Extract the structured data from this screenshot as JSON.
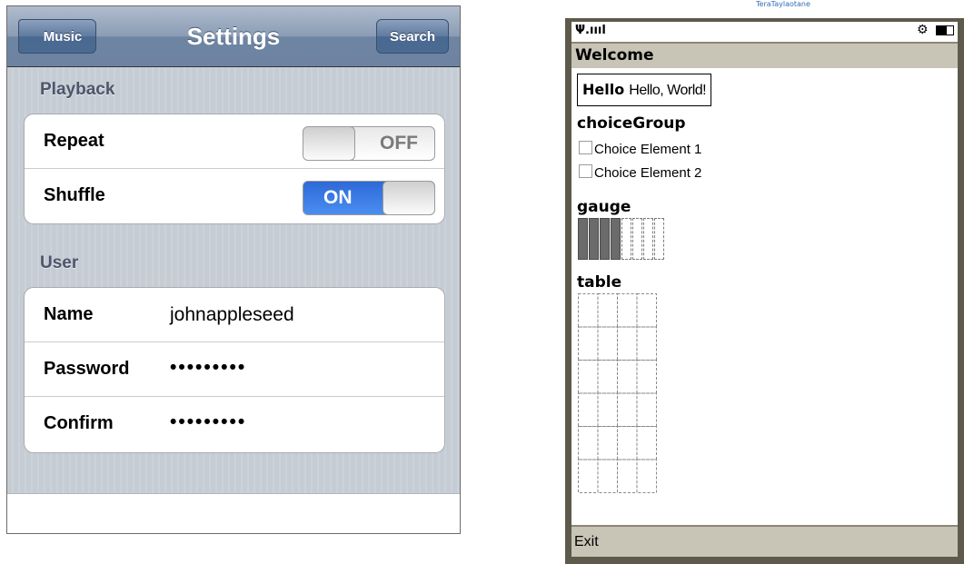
{
  "iphone": {
    "nav": {
      "title": "Settings",
      "back_label": "Music",
      "search_label": "Search"
    },
    "sections": [
      {
        "header": "Playback",
        "rows": [
          {
            "label": "Repeat",
            "switch_text": "OFF",
            "state": "off"
          },
          {
            "label": "Shuffle",
            "switch_text": "ON",
            "state": "on"
          }
        ]
      },
      {
        "header": "User",
        "rows": [
          {
            "label": "Name",
            "value": "johnappleseed"
          },
          {
            "label": "Password",
            "value": "•••••••••"
          },
          {
            "label": "Confirm",
            "value": "•••••••••"
          }
        ]
      }
    ],
    "colors": {
      "nav": "#6d84a2",
      "switch_on": "#2d69d8",
      "background": "#c5ccd4"
    }
  },
  "emulator": {
    "caption": "TeraTaylaotane",
    "status": {
      "signal": "Ψ.ıııl",
      "gear_icon": "⚙",
      "battery_icon": "battery"
    },
    "title": "Welcome",
    "string_item": {
      "label": "Hello",
      "text": "Hello, World!"
    },
    "choice_group": {
      "label": "choiceGroup",
      "choices": [
        {
          "text": "Choice Element 1",
          "checked": false
        },
        {
          "text": "Choice Element 2",
          "checked": false
        }
      ]
    },
    "gauge": {
      "label": "gauge",
      "value": 4,
      "max": 10
    },
    "table": {
      "label": "table",
      "columns": 4,
      "rows": 6
    },
    "soft_key": "Exit",
    "colors": {
      "bar": "#c8c4b6",
      "frame": "#5d5a4c"
    }
  }
}
